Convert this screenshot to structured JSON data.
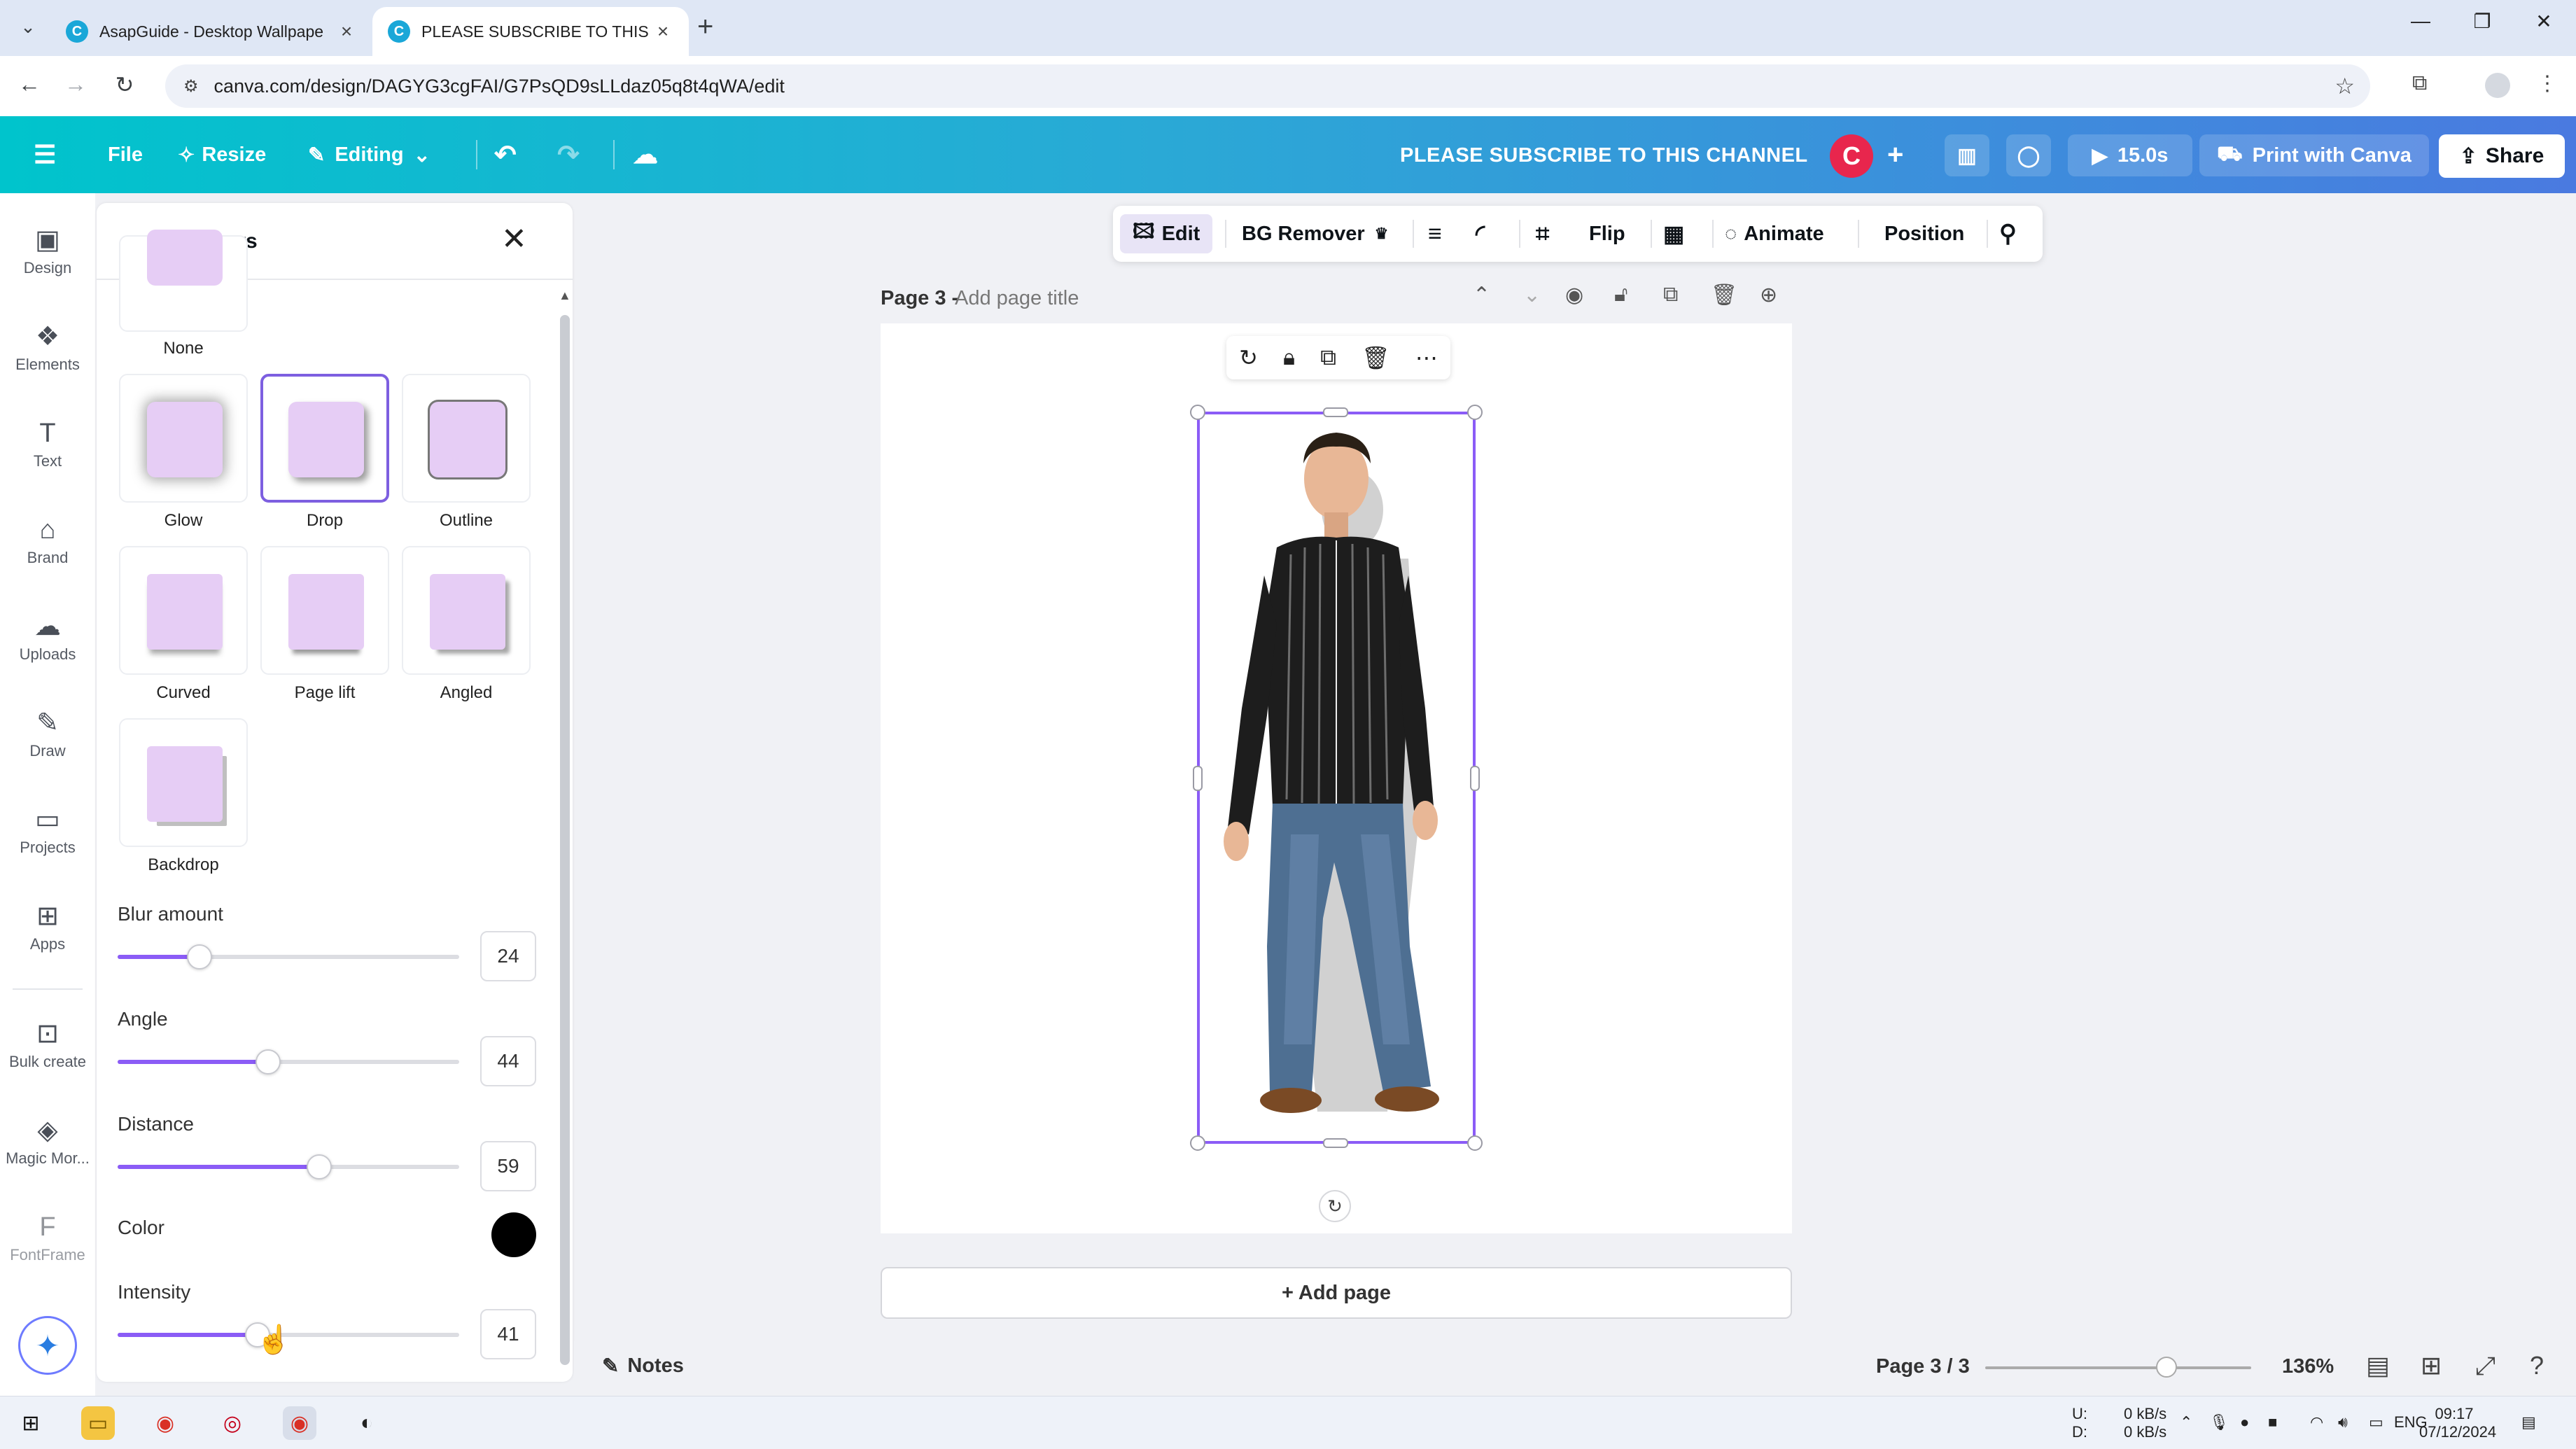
{
  "browser": {
    "tabs": [
      {
        "title": "AsapGuide - Desktop Wallpape",
        "active": false
      },
      {
        "title": "PLEASE SUBSCRIBE TO THIS CH",
        "active": true
      }
    ],
    "url": "canva.com/design/DAGYG3cgFAI/G7PsQD9sLLdaz05q8t4qWA/edit"
  },
  "header": {
    "file": "File",
    "resize": "Resize",
    "editing": "Editing",
    "design_title": "PLEASE SUBSCRIBE TO THIS CHANNEL",
    "avatar_letter": "C",
    "duration": "15.0s",
    "print": "Print with Canva",
    "share": "Share"
  },
  "rail": {
    "items": [
      {
        "label": "Design",
        "icon": "design-icon"
      },
      {
        "label": "Elements",
        "icon": "elements-icon"
      },
      {
        "label": "Text",
        "icon": "text-icon"
      },
      {
        "label": "Brand",
        "icon": "brand-icon"
      },
      {
        "label": "Uploads",
        "icon": "uploads-icon"
      },
      {
        "label": "Draw",
        "icon": "draw-icon"
      },
      {
        "label": "Projects",
        "icon": "projects-icon"
      },
      {
        "label": "Apps",
        "icon": "apps-icon"
      },
      {
        "label": "Bulk create",
        "icon": "bulk-create-icon"
      },
      {
        "label": "Magic Mor...",
        "icon": "magic-morph-icon"
      },
      {
        "label": "FontFrame",
        "icon": "fontframe-icon"
      }
    ]
  },
  "panel": {
    "title": "Shadows",
    "presets": [
      {
        "label": "None",
        "selected": false
      },
      {
        "label": "Glow",
        "selected": false
      },
      {
        "label": "Drop",
        "selected": true
      },
      {
        "label": "Outline",
        "selected": false
      },
      {
        "label": "Curved",
        "selected": false
      },
      {
        "label": "Page lift",
        "selected": false
      },
      {
        "label": "Angled",
        "selected": false
      },
      {
        "label": "Backdrop",
        "selected": false
      }
    ],
    "controls": {
      "blur": {
        "label": "Blur amount",
        "value": "24",
        "fraction": 0.24
      },
      "angle": {
        "label": "Angle",
        "value": "44",
        "fraction": 0.44
      },
      "distance": {
        "label": "Distance",
        "value": "59",
        "fraction": 0.59
      },
      "color": {
        "label": "Color",
        "hex": "#000000"
      },
      "intensity": {
        "label": "Intensity",
        "value": "41",
        "fraction": 0.41
      }
    }
  },
  "context_toolbar": {
    "edit": "Edit",
    "bg_remover": "BG Remover",
    "flip": "Flip",
    "animate": "Animate",
    "position": "Position"
  },
  "page": {
    "name": "Page 3 -",
    "title_placeholder": "Add page title",
    "add_page": "+ Add page"
  },
  "status": {
    "notes": "Notes",
    "page_indicator": "Page 3 / 3",
    "zoom": "136%"
  },
  "taskbar": {
    "net_up": "0 kB/s",
    "net_down": "0 kB/s",
    "net_up_label": "U:",
    "net_down_label": "D:",
    "lang": "ENG",
    "time": "09:17",
    "date": "07/12/2024"
  },
  "colors": {
    "accent": "#8b5cf6",
    "header_start": "#00c4cc",
    "header_end": "#4a7ae0",
    "swatch": "#e6cdf5"
  }
}
